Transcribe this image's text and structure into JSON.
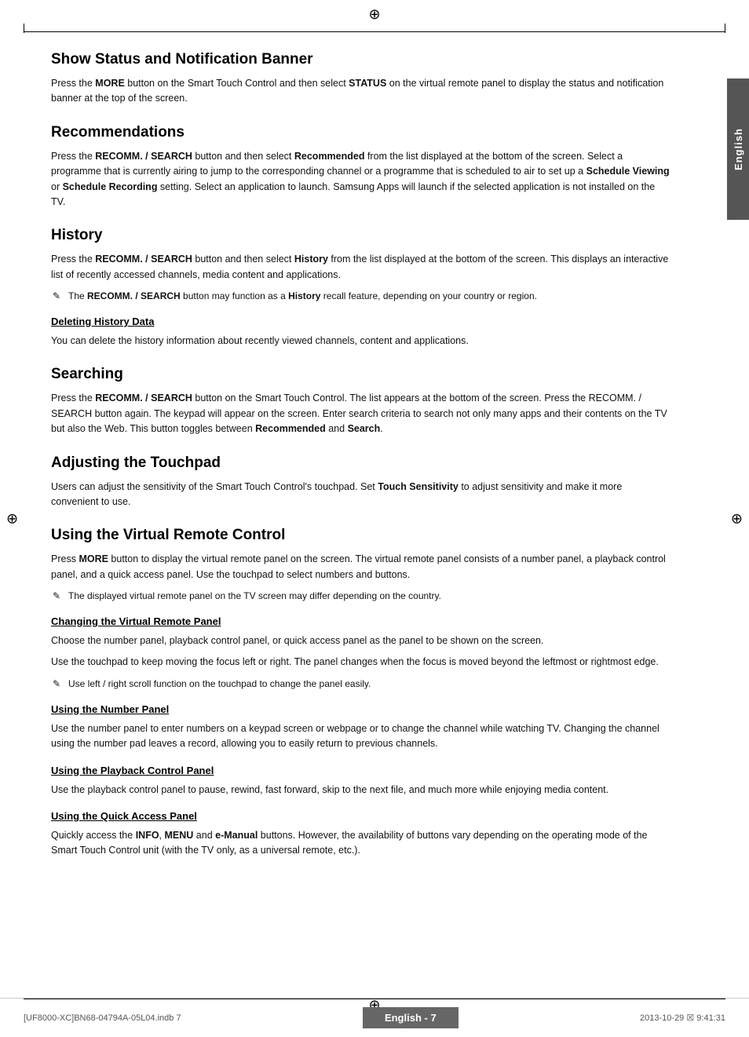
{
  "page": {
    "title": "Show Status and Notification Banner",
    "side_tab": "English",
    "footer": {
      "left": "[UF8000-XC]BN68-04794A-05L04.indb   7",
      "center": "English - 7",
      "right": "2013-10-29   ☒ 9:41:31"
    }
  },
  "sections": [
    {
      "id": "show-status",
      "type": "h2",
      "heading": "Show Status and Notification Banner",
      "paragraphs": [
        "Press the <b>MORE</b> button on the Smart Touch Control and then select <b>STATUS</b> on the virtual remote panel to display the status and notification banner at the top of the screen."
      ],
      "subsections": []
    },
    {
      "id": "recommendations",
      "type": "h2",
      "heading": "Recommendations",
      "paragraphs": [
        "Press the <b>RECOMM. / SEARCH</b> button and then select <b>Recommended</b> from the list displayed at the bottom of the screen. Select a programme that is currently airing to jump to the corresponding channel or a programme that is scheduled to air to set up a <b>Schedule Viewing</b> or <b>Schedule Recording</b> setting. Select an application to launch. Samsung Apps will launch if the selected application is not installed on the TV."
      ],
      "subsections": []
    },
    {
      "id": "history",
      "type": "h2",
      "heading": "History",
      "paragraphs": [
        "Press the <b>RECOMM. / SEARCH</b> button and then select <b>History</b> from the list displayed at the bottom of the screen. This displays an interactive list of recently accessed channels, media content and applications."
      ],
      "notes": [
        "The <b>RECOMM. / SEARCH</b> button may function as a <b>History</b> recall feature, depending on your country or region."
      ],
      "subsections": [
        {
          "id": "deleting-history",
          "heading": "Deleting History Data",
          "paragraphs": [
            "You can delete the history information about recently viewed channels, content and applications."
          ]
        }
      ]
    },
    {
      "id": "searching",
      "type": "h2",
      "heading": "Searching",
      "paragraphs": [
        "Press the <b>RECOMM. / SEARCH</b> button on the Smart Touch Control. The list appears at the bottom of the screen. Press the RECOMM. / SEARCH button again. The keypad will appear on the screen. Enter search criteria to search not only many apps and their contents on the TV but also the Web. This button toggles between <b>Recommended</b> and <b>Search</b>."
      ],
      "subsections": []
    },
    {
      "id": "adjusting-touchpad",
      "type": "h2",
      "heading": "Adjusting the Touchpad",
      "paragraphs": [
        "Users can adjust the sensitivity of the Smart Touch Control's touchpad. Set <b>Touch Sensitivity</b> to adjust sensitivity and make it more convenient to use."
      ],
      "subsections": []
    },
    {
      "id": "virtual-remote",
      "type": "h2",
      "heading": "Using the Virtual Remote Control",
      "paragraphs": [
        "Press <b>MORE</b> button to display the virtual remote panel on the screen. The virtual remote panel consists of a number panel, a playback control panel, and a quick access panel. Use the touchpad to select numbers and buttons."
      ],
      "notes": [
        "The displayed virtual remote panel on the TV screen may differ depending on the country."
      ],
      "subsections": [
        {
          "id": "changing-virtual-remote",
          "heading": "Changing the Virtual Remote Panel",
          "paragraphs": [
            "Choose the number panel, playback control panel, or quick access panel as the panel to be shown on the screen.",
            "Use the touchpad to keep moving the focus left or right. The panel changes when the focus is moved beyond the leftmost or rightmost edge."
          ],
          "notes": [
            "Use left / right scroll function on the touchpad to change the panel easily."
          ]
        },
        {
          "id": "number-panel",
          "heading": "Using the Number Panel",
          "paragraphs": [
            "Use the number panel to enter numbers on a keypad screen or webpage or to change the channel while watching TV. Changing the channel using the number pad leaves a record, allowing you to easily return to previous channels."
          ]
        },
        {
          "id": "playback-control",
          "heading": "Using the Playback Control Panel",
          "paragraphs": [
            "Use the playback control panel to pause, rewind, fast forward, skip to the next file, and much more while enjoying media content."
          ]
        },
        {
          "id": "quick-access",
          "heading": "Using the Quick Access Panel",
          "paragraphs": [
            "Quickly access the <b>INFO</b>, <b>MENU</b> and <b>e-Manual</b> buttons. However, the availability of buttons vary depending on the operating mode of the Smart Touch Control unit (with the TV only, as a universal remote, etc.)."
          ]
        }
      ]
    }
  ]
}
